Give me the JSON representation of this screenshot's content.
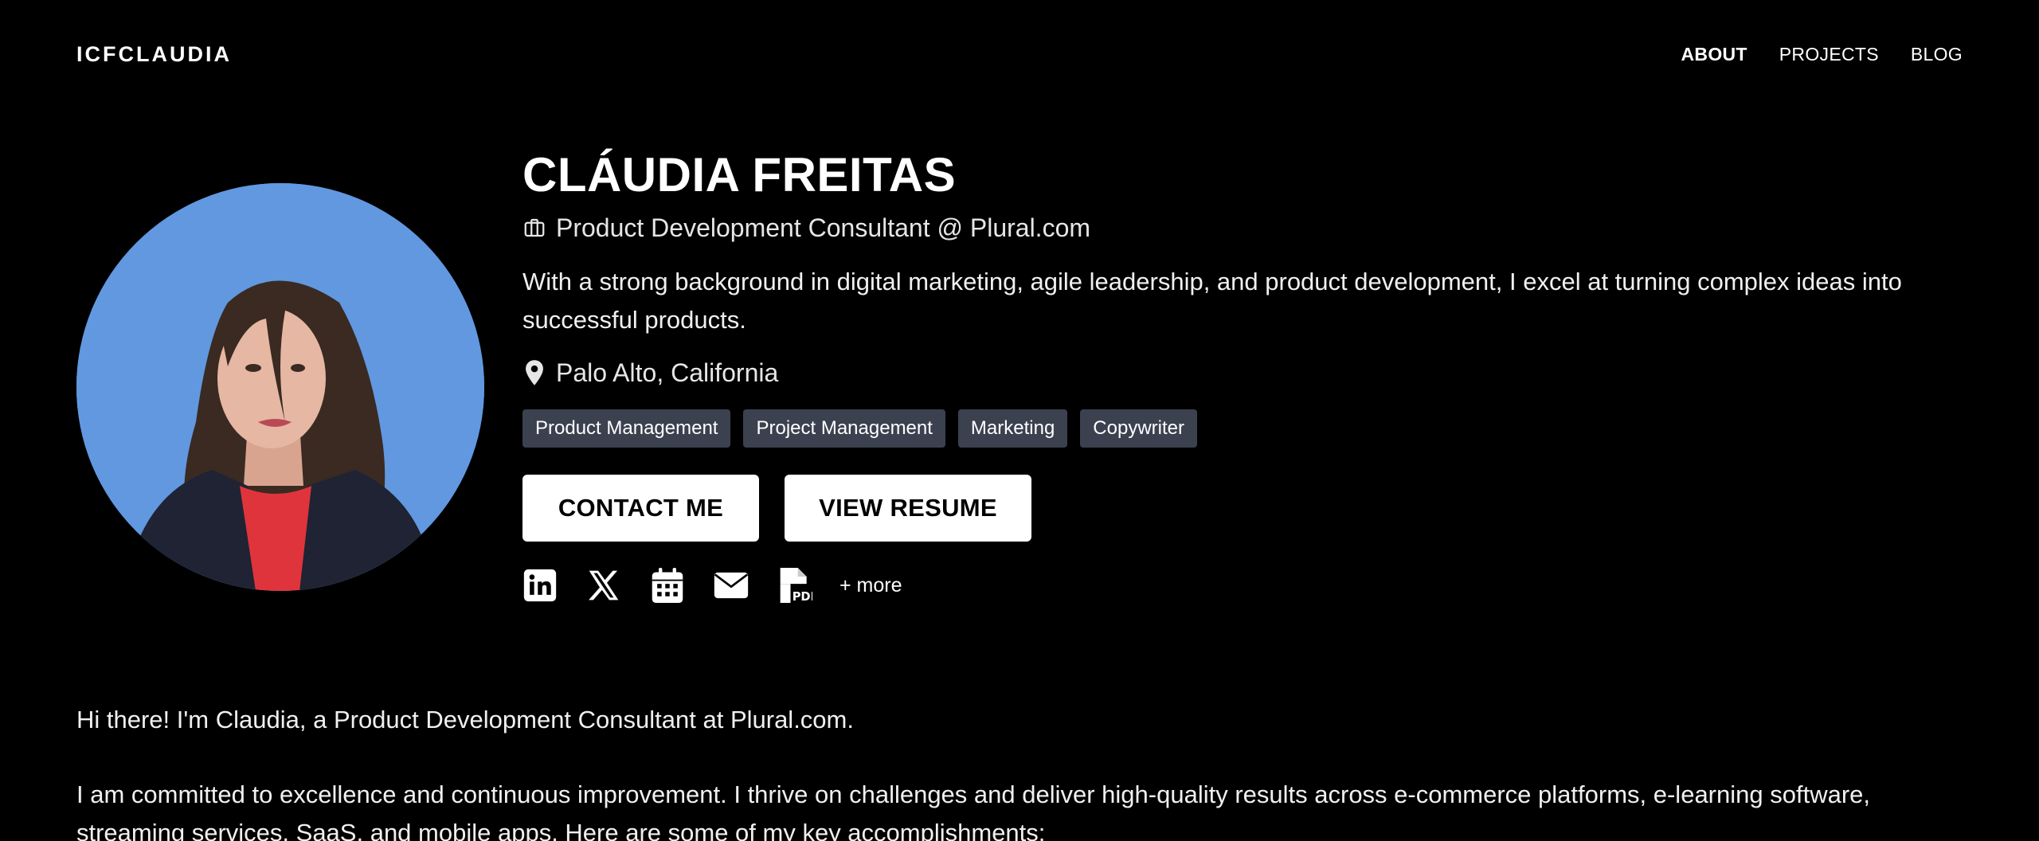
{
  "header": {
    "brand": "ICFCLAUDIA",
    "nav": [
      {
        "label": "ABOUT",
        "active": true
      },
      {
        "label": "PROJECTS",
        "active": false
      },
      {
        "label": "BLOG",
        "active": false
      }
    ]
  },
  "profile": {
    "name": "CLÁUDIA FREITAS",
    "role": "Product Development Consultant @ Plural.com",
    "bio": "With a strong background in digital marketing, agile leadership, and product development, I excel at turning complex ideas into successful products.",
    "location": "Palo Alto, California",
    "tags": [
      "Product Management",
      "Project Management",
      "Marketing",
      "Copywriter"
    ],
    "buttons": {
      "contact": "CONTACT ME",
      "resume": "VIEW RESUME"
    },
    "socials": [
      {
        "icon": "linkedin-icon"
      },
      {
        "icon": "x-icon"
      },
      {
        "icon": "calendar-icon"
      },
      {
        "icon": "email-icon"
      },
      {
        "icon": "pdf-icon"
      }
    ],
    "more_label": "+ more"
  },
  "about": {
    "intro": "Hi there! I'm Claudia, a Product Development Consultant at Plural.com.",
    "paragraph": "I am committed to excellence and continuous improvement. I thrive on challenges and deliver high-quality results across e-commerce platforms, e-learning software, streaming services, SaaS, and mobile apps. Here are some of my key accomplishments:"
  },
  "colors": {
    "background": "#000000",
    "tag_bg": "#3c4150",
    "avatar_bg": "#5d94dd"
  }
}
